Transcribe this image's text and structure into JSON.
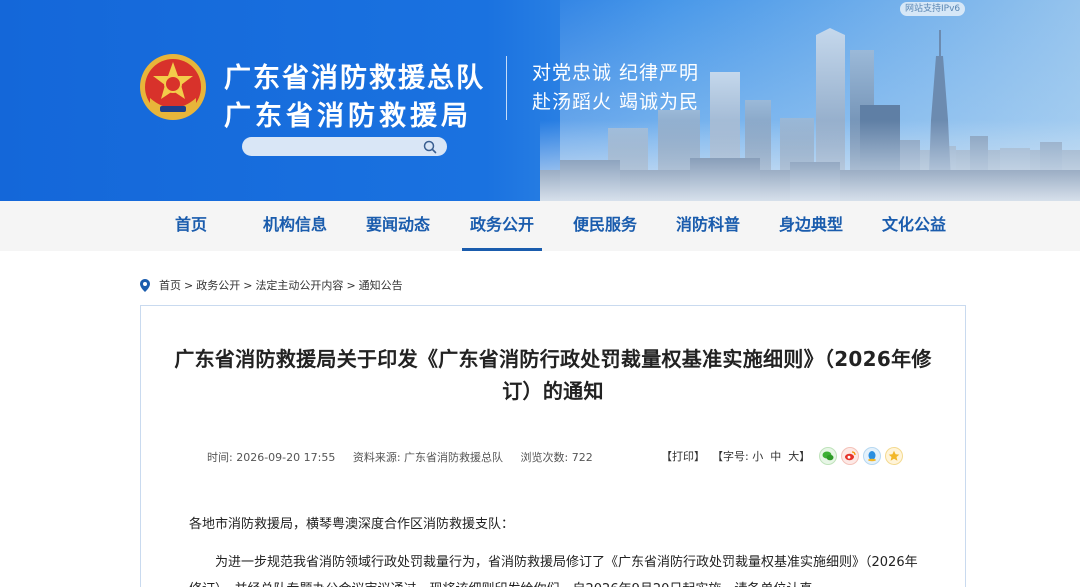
{
  "header": {
    "ipv6_badge": "网站支持IPv6",
    "title_line1": "广东省消防救援总队",
    "title_line2": "广东省消防救援局",
    "motto_line1": "对党忠诚 纪律严明",
    "motto_line2": "赴汤蹈火 竭诚为民",
    "search": {
      "value": "",
      "placeholder": ""
    }
  },
  "nav": {
    "items": [
      {
        "label": "首页"
      },
      {
        "label": "机构信息"
      },
      {
        "label": "要闻动态"
      },
      {
        "label": "政务公开",
        "active": true
      },
      {
        "label": "便民服务"
      },
      {
        "label": "消防科普"
      },
      {
        "label": "身边典型"
      },
      {
        "label": "文化公益"
      }
    ]
  },
  "breadcrumb": {
    "items": [
      "首页",
      "政务公开",
      "法定主动公开内容",
      "通知公告"
    ],
    "separator": ">"
  },
  "article": {
    "title": "广东省消防救援局关于印发《广东省消防行政处罚裁量权基准实施细则》（2026年修订）的通知",
    "time_label": "时间:",
    "time": "2026-09-20 17:55",
    "source_label": "资料来源:",
    "source": "广东省消防救援总队",
    "views_label": "浏览次数:",
    "views": "722",
    "print_label": "【打印】",
    "font_label": "【字号:",
    "font_small": "小",
    "font_medium": "中",
    "font_large": "大】",
    "greeting": "各地市消防救援局，横琴粤澳深度合作区消防救援支队：",
    "paragraph1": "为进一步规范我省消防领域行政处罚裁量行为，省消防救援局修订了《广东省消防行政处罚裁量权基准实施细则》（2026年修订），并经总队专题办公会议审议通过，现将该细则印发给你们，自2026年9月20日起实施。请各单位认真"
  },
  "share_icons": [
    "wechat-icon",
    "weibo-icon",
    "qq-icon",
    "qzone-icon"
  ],
  "colors": {
    "nav_text": "#1a5cad",
    "banner_blue": "#1467d9",
    "card_border": "#c9daef"
  }
}
